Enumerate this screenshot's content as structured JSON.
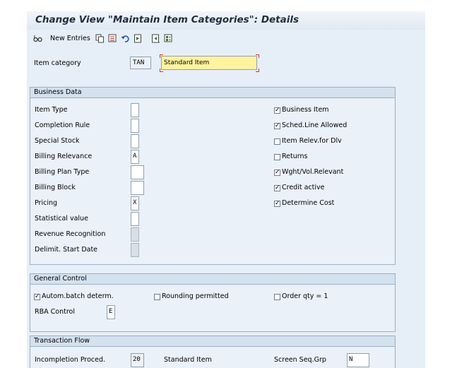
{
  "header": {
    "title": "Change View \"Maintain Item Categories\": Details"
  },
  "toolbar": {
    "new_entries": "New Entries",
    "icons": [
      "glasses-icon",
      "copy-icon",
      "save-as-icon",
      "undo-icon",
      "previous-icon",
      "next-icon",
      "variant-icon"
    ]
  },
  "item_category": {
    "label": "Item category",
    "code": "TAN",
    "description": "Standard Item"
  },
  "business_data": {
    "title": "Business Data",
    "left": [
      {
        "label": "Item Type",
        "value": ""
      },
      {
        "label": "Completion Rule",
        "value": ""
      },
      {
        "label": "Special Stock",
        "value": ""
      },
      {
        "label": "Billing Relevance",
        "value": "A"
      },
      {
        "label": "Billing Plan Type",
        "value": ""
      },
      {
        "label": "Billing Block",
        "value": ""
      },
      {
        "label": "Pricing",
        "value": "X"
      },
      {
        "label": "Statistical value",
        "value": ""
      },
      {
        "label": "Revenue Recognition",
        "value": ""
      },
      {
        "label": "Delimit. Start Date",
        "value": ""
      }
    ],
    "right": [
      {
        "label": "Business Item",
        "checked": true
      },
      {
        "label": "Sched.Line Allowed",
        "checked": true
      },
      {
        "label": "Item Relev.for Dlv",
        "checked": false
      },
      {
        "label": "Returns",
        "checked": false
      },
      {
        "label": "Wght/Vol.Relevant",
        "checked": true
      },
      {
        "label": "Credit active",
        "checked": true
      },
      {
        "label": "Determine Cost",
        "checked": true
      }
    ]
  },
  "general_control": {
    "title": "General Control",
    "autom_batch": {
      "label": "Autom.batch determ.",
      "checked": true
    },
    "rounding": {
      "label": "Rounding permitted",
      "checked": false
    },
    "order_qty": {
      "label": "Order qty = 1",
      "checked": false
    },
    "rba_label": "RBA Control",
    "rba_value": "E"
  },
  "transaction_flow": {
    "title": "Transaction Flow",
    "incompletion_label": "Incompletion Proced.",
    "incompletion_value": "20",
    "incompletion_text": "Standard Item",
    "screen_seq_label": "Screen Seq.Grp",
    "screen_seq_value": "N"
  }
}
